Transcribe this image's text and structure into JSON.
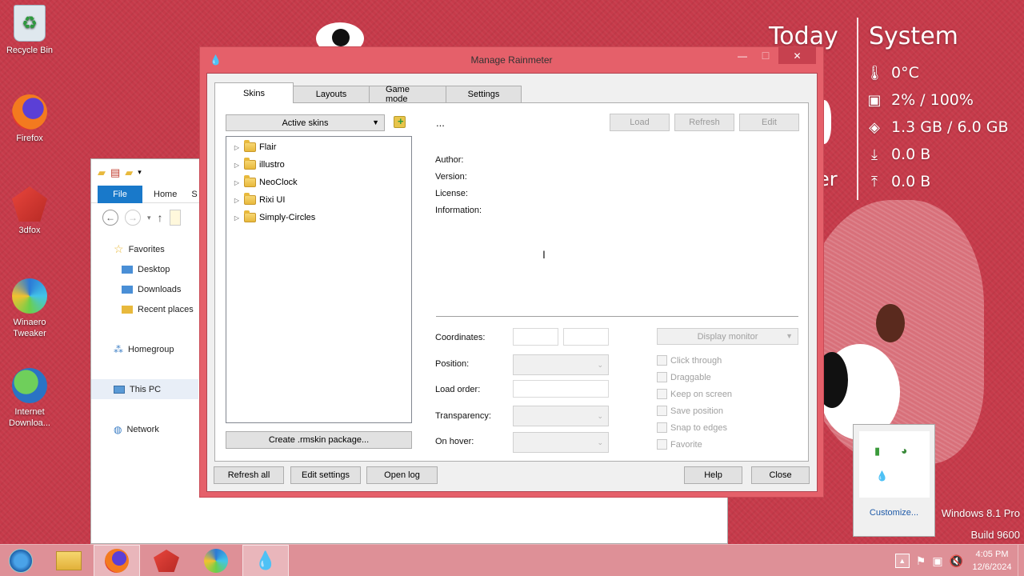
{
  "desktop": {
    "icons": [
      {
        "label": "Recycle Bin",
        "icon": "recycle-bin-icon"
      },
      {
        "label": "Firefox",
        "icon": "firefox-icon"
      },
      {
        "label": "3dfox",
        "icon": "3dfox-icon"
      },
      {
        "label": "Winaero Tweaker",
        "icon": "winaero-tweaker-icon"
      },
      {
        "label": "Internet Downloa...",
        "icon": "internet-download-manager-icon"
      }
    ]
  },
  "rainmeter_widgets": {
    "today_label": "Today",
    "system_label": "System",
    "partial_text": "er",
    "temperature": "0°C",
    "cpu": "2% / 100%",
    "ram": "1.3 GB / 6.0 GB",
    "download": "0.0 B",
    "upload": "0.0 B"
  },
  "explorer": {
    "ribbon": {
      "file_tab": "File",
      "home_tab": "Home",
      "partial_tab": "S"
    },
    "nav": {
      "favorites": "Favorites",
      "desktop": "Desktop",
      "downloads": "Downloads",
      "recent_places": "Recent places",
      "homegroup": "Homegroup",
      "this_pc": "This PC",
      "network": "Network"
    }
  },
  "manager": {
    "title": "Manage Rainmeter",
    "window_controls": {
      "minimize": "—",
      "maximize": "☐",
      "close": "✕"
    },
    "tabs": [
      "Skins",
      "Layouts",
      "Game mode",
      "Settings"
    ],
    "active_skins_dropdown": "Active skins",
    "skin_name": "...",
    "buttons": {
      "load": "Load",
      "refresh": "Refresh",
      "edit": "Edit"
    },
    "skins_tree": [
      "Flair",
      "illustro",
      "NeoClock",
      "Rixi UI",
      "Simply-Circles"
    ],
    "info_labels": {
      "author": "Author:",
      "version": "Version:",
      "license": "License:",
      "information": "Information:"
    },
    "create_package": "Create .rmskin package...",
    "settings_labels": {
      "coordinates": "Coordinates:",
      "position": "Position:",
      "load_order": "Load order:",
      "transparency": "Transparency:",
      "on_hover": "On hover:"
    },
    "display_monitor": "Display monitor",
    "checkboxes": [
      "Click through",
      "Draggable",
      "Keep on screen",
      "Save position",
      "Snap to edges",
      "Favorite"
    ],
    "footer": {
      "refresh_all": "Refresh all",
      "edit_settings": "Edit settings",
      "open_log": "Open log",
      "help": "Help",
      "close": "Close"
    }
  },
  "tray_popup": {
    "customize": "Customize..."
  },
  "os_version": {
    "line1": "Windows 8.1 Pro",
    "line2": "Build 9600"
  },
  "taskbar": {
    "items": [
      "start-button",
      "file-explorer",
      "firefox",
      "3dfox",
      "edge",
      "rainmeter"
    ],
    "clock_time": "4:05 PM",
    "clock_date": "12/6/2024"
  },
  "colors": {
    "desktop_bg": "#c63a4a",
    "window_frame": "#e5606a",
    "file_tab": "#1979ca",
    "link": "#1e5aa8"
  }
}
